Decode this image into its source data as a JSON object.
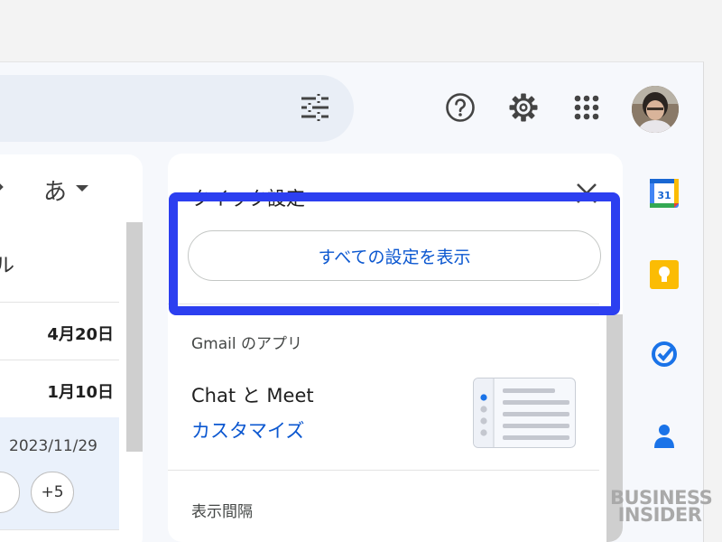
{
  "sort_label": "あ",
  "partial_label": "ル",
  "mail_dates": [
    "4月20日",
    "1月10日"
  ],
  "selected_row": {
    "date": "2023/11/29",
    "chip": "+5"
  },
  "quick_settings": {
    "title": "クイック設定",
    "see_all_button": "すべての設定を表示",
    "apps_section": "Gmail のアプリ",
    "chat_meet": "Chat と Meet",
    "customize_link": "カスタマイズ",
    "density_section": "表示間隔"
  },
  "side_apps": [
    "calendar-icon",
    "keep-icon",
    "tasks-icon",
    "contacts-icon"
  ],
  "calendar_day": "31",
  "watermark": {
    "line1": "BUSINESS",
    "line2": "INSIDER"
  },
  "colors": {
    "accent_blue": "#0b57d0",
    "focus_outline": "#2c3ff0",
    "keep_yellow": "#fbbc04"
  }
}
